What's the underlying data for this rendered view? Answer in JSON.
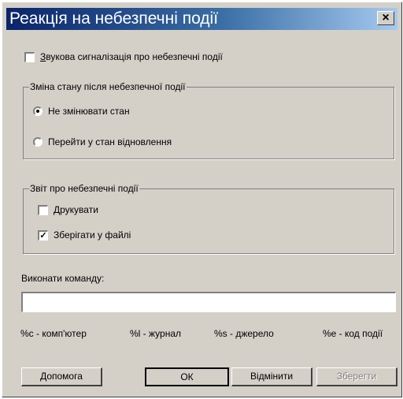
{
  "window": {
    "title": "Реакція на небезпечні події",
    "close_glyph": "×"
  },
  "sound_alarm": {
    "label_accel": "З",
    "label_rest": "вукова сигналізація про небезпечні події",
    "checked": false
  },
  "state_group": {
    "legend": "Зміна стану після небезпечної події",
    "options": [
      {
        "label": "Не змінювати стан",
        "selected": true
      },
      {
        "label": "Перейти у стан відновлення",
        "selected": false
      }
    ]
  },
  "report_group": {
    "legend": "Звіт про небезпечні події",
    "print": {
      "label": "Друкувати",
      "checked": false
    },
    "save_file": {
      "label": "Зберігати у файлі",
      "checked": true
    }
  },
  "command": {
    "label": "Виконати команду:",
    "value": ""
  },
  "hints": [
    "%c - комп'ютер",
    "%l - журнал",
    "%s - джерело",
    "%e - код події"
  ],
  "buttons": {
    "help": "Допомога",
    "ok": "ОК",
    "cancel": "Відмінити",
    "save": "Зберегти"
  }
}
